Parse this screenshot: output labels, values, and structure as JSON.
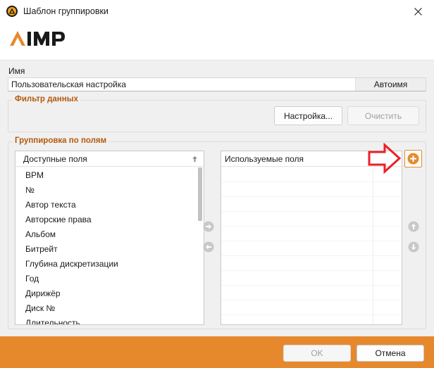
{
  "window": {
    "title": "Шаблон группировки"
  },
  "name_section": {
    "label": "Имя",
    "value": "Пользовательская настройка",
    "autoname_label": "Автоимя"
  },
  "filter_section": {
    "legend": "Фильтр данных",
    "settings_label": "Настройка...",
    "clear_label": "Очистить"
  },
  "grouping_section": {
    "legend": "Группировка по полям",
    "available": {
      "header": "Доступные поля",
      "items": [
        "BPM",
        "№",
        "Автор текста",
        "Авторские права",
        "Альбом",
        "Битрейт",
        "Глубина дискретизации",
        "Год",
        "Дирижёр",
        "Диск №",
        "Длительность"
      ]
    },
    "used": {
      "header": "Используемые поля",
      "items": []
    }
  },
  "footer": {
    "ok_label": "OK",
    "cancel_label": "Отмена"
  },
  "colors": {
    "accent": "#e6892d",
    "legend_text": "#b35a0c",
    "annotation_arrow": "#e8222a"
  }
}
